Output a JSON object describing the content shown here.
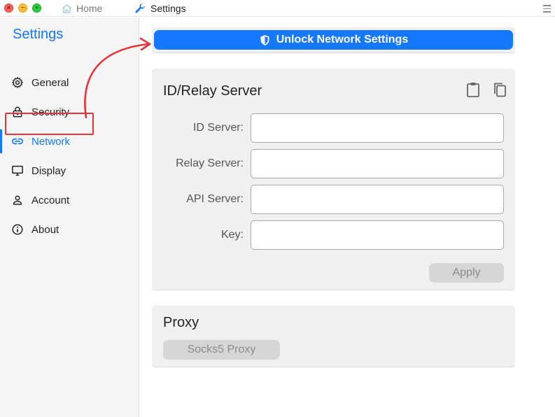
{
  "titlebar": {
    "tabs": [
      {
        "label": "Home",
        "icon": "home-icon"
      },
      {
        "label": "Settings",
        "icon": "wrench-icon"
      }
    ]
  },
  "sidebar": {
    "title": "Settings",
    "items": [
      {
        "label": "General",
        "icon": "gear-icon"
      },
      {
        "label": "Security",
        "icon": "lock-icon"
      },
      {
        "label": "Network",
        "icon": "link-icon",
        "active": true
      },
      {
        "label": "Display",
        "icon": "monitor-icon"
      },
      {
        "label": "Account",
        "icon": "person-icon"
      },
      {
        "label": "About",
        "icon": "info-icon"
      }
    ]
  },
  "main": {
    "unlock_button": "Unlock Network Settings",
    "relay_card": {
      "title": "ID/Relay Server",
      "fields": [
        {
          "label": "ID Server:",
          "value": ""
        },
        {
          "label": "Relay Server:",
          "value": ""
        },
        {
          "label": "API Server:",
          "value": ""
        },
        {
          "label": "Key:",
          "value": ""
        }
      ],
      "apply_button": "Apply"
    },
    "proxy_card": {
      "title": "Proxy",
      "socks_button": "Socks5 Proxy"
    }
  },
  "colors": {
    "accent": "#1677ff",
    "annotation": "#e8323c",
    "disabled_button": "#d6d6d6"
  }
}
